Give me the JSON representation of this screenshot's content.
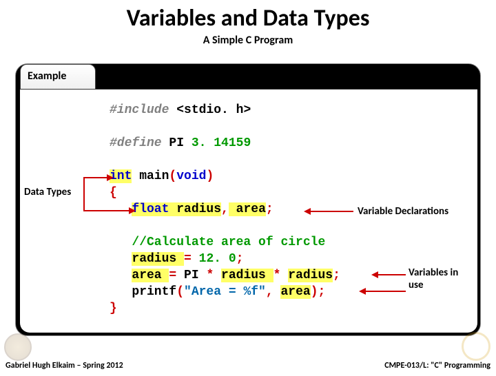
{
  "title": "Variables and Data Types",
  "subtitle": "A Simple C Program",
  "tab_label": "Example",
  "code": {
    "include_kw": "#include",
    "include_lib": " <stdio. h>",
    "define_kw": "#define",
    "define_name": " PI ",
    "define_val": "3. 14159",
    "int_kw": "int",
    "main_fn": " main",
    "lparen": "(",
    "void_kw": "void",
    "rparen": ")",
    "lbrace": "{",
    "float_kw": "float",
    "radius": " radius",
    "comma": ",",
    "area": " area",
    "semi": ";",
    "comment": "//Calculate area of circle",
    "line_r_assign": "radius ",
    "eq": "= ",
    "twelve": "12. 0",
    "line_a_assign": "area ",
    "pi": "PI ",
    "star": "* ",
    "radius_tok": "radius ",
    "radius_tok2": "radius",
    "printf": "printf",
    "str": "\"Area = %f\"",
    "comma2": ", ",
    "area_tok": "area",
    "rbrace": "}"
  },
  "labels": {
    "data_types": "Data Types",
    "var_decl": "Variable Declarations",
    "vars_in_use1": "Variables in",
    "vars_in_use2": "use"
  },
  "footer": {
    "left": "Gabriel Hugh Elkaim – Spring 2012",
    "right": "CMPE-013/L: \"C\" Programming"
  }
}
